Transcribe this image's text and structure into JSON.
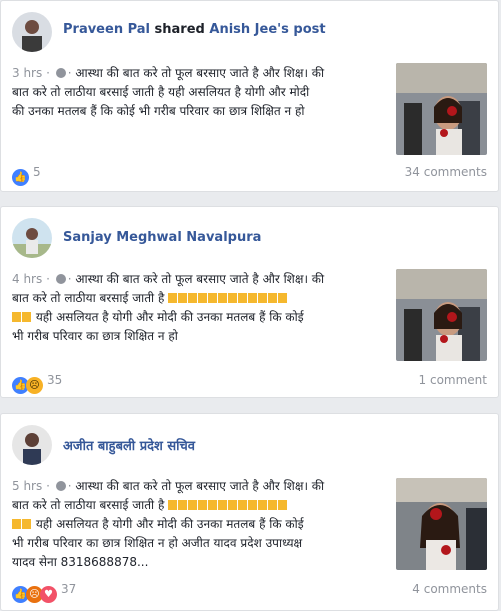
{
  "posts": [
    {
      "author": "Praveen Pal",
      "shared_text": "shared",
      "shared_source": "Anish Jee's post",
      "time": "3 hrs",
      "line1": "आस्था की बात करे तो फूल बरसाए जाते है और शिक्ष। की",
      "line2": "बात करे तो लाठीया बरसाई जाती है यही असलियत है योगी और मोदी",
      "line3": "की उनका मतलब हैं कि कोई भी गरीब परिवार का छात्र शिक्षित न हो",
      "reactions": [
        "like-icon"
      ],
      "reaction_count": "5",
      "comments": "34 comments"
    },
    {
      "author": "Sanjay Meghwal Navalpura",
      "time": "4 hrs",
      "line1": "आस्था की बात करे तो फूल बरसाए जाते है और शिक्ष। की",
      "line2": "बात करे तो लाठीया बरसाई जाती है",
      "line3": "यही असलियत है योगी और मोदी की उनका मतलब हैं कि कोई",
      "line4": "भी गरीब परिवार का छात्र शिक्षित न हो",
      "reactions": [
        "like-icon",
        "sad-icon"
      ],
      "reaction_count": "35",
      "comments": "1 comment"
    },
    {
      "author": "अजीत बाहुबली प्रदेश सचिव",
      "time": "5 hrs",
      "line1": "आस्था की बात करे तो फूल बरसाए जाते है और शिक्ष। की",
      "line2": "बात करे तो लाठीया बरसाई जाती है",
      "line3": "यही असलियत है योगी और मोदी की उनका मतलब हैं कि कोई",
      "line4": "भी गरीब परिवार का छात्र शिक्षित न हो अजीत यादव प्रदेश उपाध्यक्ष",
      "line5": "यादव सेना 8318688878...",
      "reactions": [
        "like-icon",
        "angry-icon",
        "love-icon"
      ],
      "reaction_count": "37",
      "comments": "4 comments"
    }
  ],
  "colors": {
    "link": "#365899",
    "meta": "#90949c",
    "like": "#4080ff"
  }
}
